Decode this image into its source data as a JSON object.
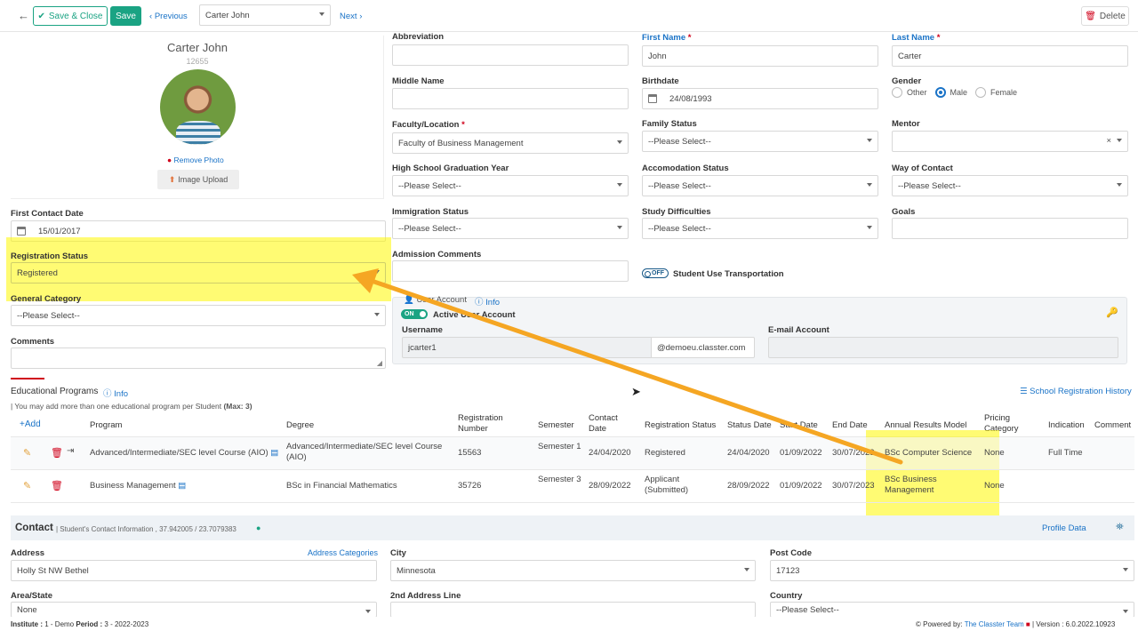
{
  "toolbar": {
    "save_close": "Save & Close",
    "save": "Save",
    "previous": "Previous",
    "student_select": "Carter John",
    "next": "Next",
    "delete": "Delete"
  },
  "profile": {
    "name": "Carter John",
    "id": "12655",
    "remove_photo": "Remove Photo",
    "image_upload": "Image Upload"
  },
  "left": {
    "first_contact_date_label": "First Contact Date",
    "first_contact_date": "15/01/2017",
    "registration_status_label": "Registration Status",
    "registration_status": "Registered",
    "general_category_label": "General Category",
    "general_category": "--Please Select--",
    "comments_label": "Comments"
  },
  "form": {
    "abbreviation_label": "Abbreviation",
    "first_name_label": "First Name",
    "first_name": "John",
    "last_name_label": "Last Name",
    "last_name": "Carter",
    "middle_name_label": "Middle Name",
    "birthdate_label": "Birthdate",
    "birthdate": "24/08/1993",
    "gender_label": "Gender",
    "gender_other": "Other",
    "gender_male": "Male",
    "gender_female": "Female",
    "faculty_label": "Faculty/Location",
    "faculty": "Faculty of Business Management",
    "family_status_label": "Family Status",
    "family_status": "--Please Select--",
    "mentor_label": "Mentor",
    "mentor_clear": "×",
    "hs_grad_label": "High School Graduation Year",
    "hs_grad": "--Please Select--",
    "accommodation_label": "Accomodation Status",
    "accommodation": "--Please Select--",
    "way_of_contact_label": "Way of Contact",
    "way_of_contact": "--Please Select--",
    "immigration_label": "Immigration Status",
    "immigration": "--Please Select--",
    "study_difficulties_label": "Study Difficulties",
    "study_difficulties": "--Please Select--",
    "goals_label": "Goals",
    "admission_comments_label": "Admission Comments",
    "transport_toggle": "OFF",
    "transport_label": "Student Use Transportation"
  },
  "user_account": {
    "title": "User Account",
    "info": "Info",
    "toggle": "ON",
    "active_label": "Active User Account",
    "username_label": "Username",
    "username": "jcarter1",
    "domain": "@demoeu.classter.com",
    "email_label": "E-mail Account"
  },
  "programs": {
    "title": "Educational Programs",
    "info": "Info",
    "note_prefix": "| You may add more than one educational program per Student",
    "note_max": "(Max: 3)",
    "history": "School Registration History",
    "add": "Add",
    "headers": [
      "Program",
      "Degree",
      "Registration Number",
      "Semester",
      "Contact Date",
      "Registration Status",
      "Status Date",
      "Start Date",
      "End Date",
      "Annual Results Model",
      "Pricing Category",
      "Indication",
      "Comment"
    ],
    "rows": [
      {
        "program": "Advanced/Intermediate/SEC level Course (AIO)",
        "degree": "Advanced/Intermediate/SEC level Course (AIO)",
        "reg_number": "15563",
        "semester": "Semester 1",
        "contact_date": "24/04/2020",
        "reg_status": "Registered",
        "status_date": "24/04/2020",
        "start_date": "01/09/2022",
        "end_date": "30/07/2023",
        "results_model": "BSc Computer Science",
        "pricing": "None",
        "indication": "Full Time"
      },
      {
        "program": "Business Management",
        "degree": "BSc in Financial Mathematics",
        "reg_number": "35726",
        "semester": "Semester 3",
        "contact_date": "28/09/2022",
        "reg_status": "Applicant (Submitted)",
        "status_date": "28/09/2022",
        "start_date": "01/09/2022",
        "end_date": "30/07/2023",
        "results_model": "BSc Business Management",
        "pricing": "None",
        "indication": ""
      }
    ]
  },
  "contact": {
    "title": "Contact",
    "subtitle": "| Student's Contact Information , 37.942005 / 23.7079383",
    "profile_data": "Profile Data",
    "address_label": "Address",
    "address_categories": "Address Categories",
    "address": "Holly St NW Bethel",
    "city_label": "City",
    "city": "Minnesota",
    "post_code_label": "Post Code",
    "post_code": "17123",
    "area_label": "Area/State",
    "area": "None",
    "address2_label": "2nd Address Line",
    "country_label": "Country",
    "country": "--Please Select--"
  },
  "footer": {
    "institute_label": "Institute :",
    "institute": "1 - Demo",
    "period_label": "Period :",
    "period": "3 - 2022-2023",
    "powered_by": "Powered by:",
    "team": "The Classter Team",
    "version": "| Version : 6.0.2022.10923"
  },
  "colors": {
    "accent_green": "#1aa383",
    "link_blue": "#1a73c7",
    "highlight_yellow": "#fff700",
    "arrow_orange": "#f5a623"
  }
}
